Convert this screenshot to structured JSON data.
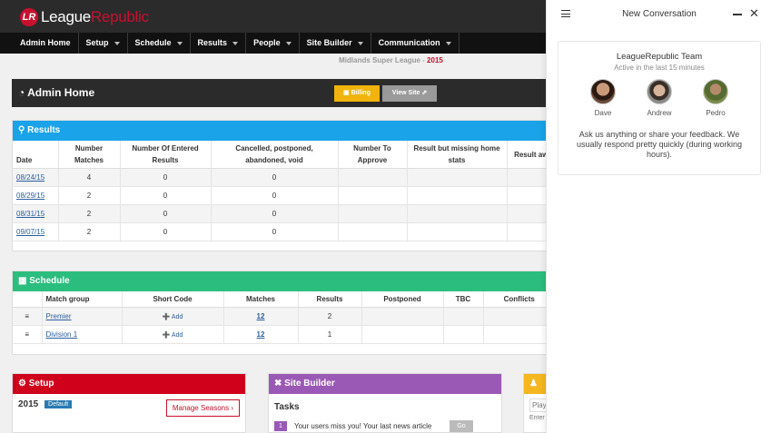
{
  "brand": {
    "mark": "LR",
    "name_part1": "League",
    "name_part2": "Republic"
  },
  "menu": [
    "Admin Home",
    "Setup",
    "Schedule",
    "Results",
    "People",
    "Site Builder",
    "Communication"
  ],
  "league": {
    "name": "Midlands Super League",
    "sep": " - ",
    "year": "2015"
  },
  "admin": {
    "title": "Admin Home",
    "billing_label": "Billing",
    "viewsite_label": "View Site"
  },
  "results": {
    "title": "Results",
    "columns": [
      "Date",
      "Number Matches",
      "Number Of Entered Results",
      "Cancelled, postponed, abandoned, void",
      "Number To Approve",
      "Result but missing home stats",
      "Result aw"
    ],
    "rows": [
      {
        "date": "08/24/15",
        "matches": "4",
        "entered": "0",
        "cancelled": "0"
      },
      {
        "date": "08/29/15",
        "matches": "2",
        "entered": "0",
        "cancelled": "0"
      },
      {
        "date": "08/31/15",
        "matches": "2",
        "entered": "0",
        "cancelled": "0"
      },
      {
        "date": "09/07/15",
        "matches": "2",
        "entered": "0",
        "cancelled": "0"
      }
    ]
  },
  "schedule": {
    "title": "Schedule",
    "columns": [
      "Match group",
      "Short Code",
      "Matches",
      "Results",
      "Postponed",
      "TBC",
      "Conflicts"
    ],
    "rows": [
      {
        "group": "Premier",
        "short": "Add",
        "matches": "12",
        "results": "2"
      },
      {
        "group": "Division 1",
        "short": "Add",
        "matches": "12",
        "results": "1"
      }
    ]
  },
  "setup": {
    "title": "Setup",
    "year": "2015",
    "badge": "Default",
    "manage_label": "Manage Seasons"
  },
  "site_builder": {
    "title": "Site Builder",
    "tasks_title": "Tasks",
    "task_num": "1",
    "task_text": "Your users miss you! Your last news article",
    "go_label": "Go"
  },
  "people_panel": {
    "search_placeholder": "Play",
    "hint": "Enter"
  },
  "chat": {
    "header_title": "New Conversation",
    "team_name": "LeagueRepublic Team",
    "active": "Active in the last 15 minutes",
    "agents": [
      "Dave",
      "Andrew",
      "Pedro"
    ],
    "message": "Ask us anything or share your feedback. We usually respond pretty quickly (during working hours)."
  },
  "colors": {
    "brand_red": "#c8102e",
    "results_blue": "#1aa3e8",
    "schedule_green": "#2bbd7e",
    "setup_red": "#d0021b",
    "builder_purple": "#9b59b6",
    "people_yellow": "#f5b720"
  }
}
